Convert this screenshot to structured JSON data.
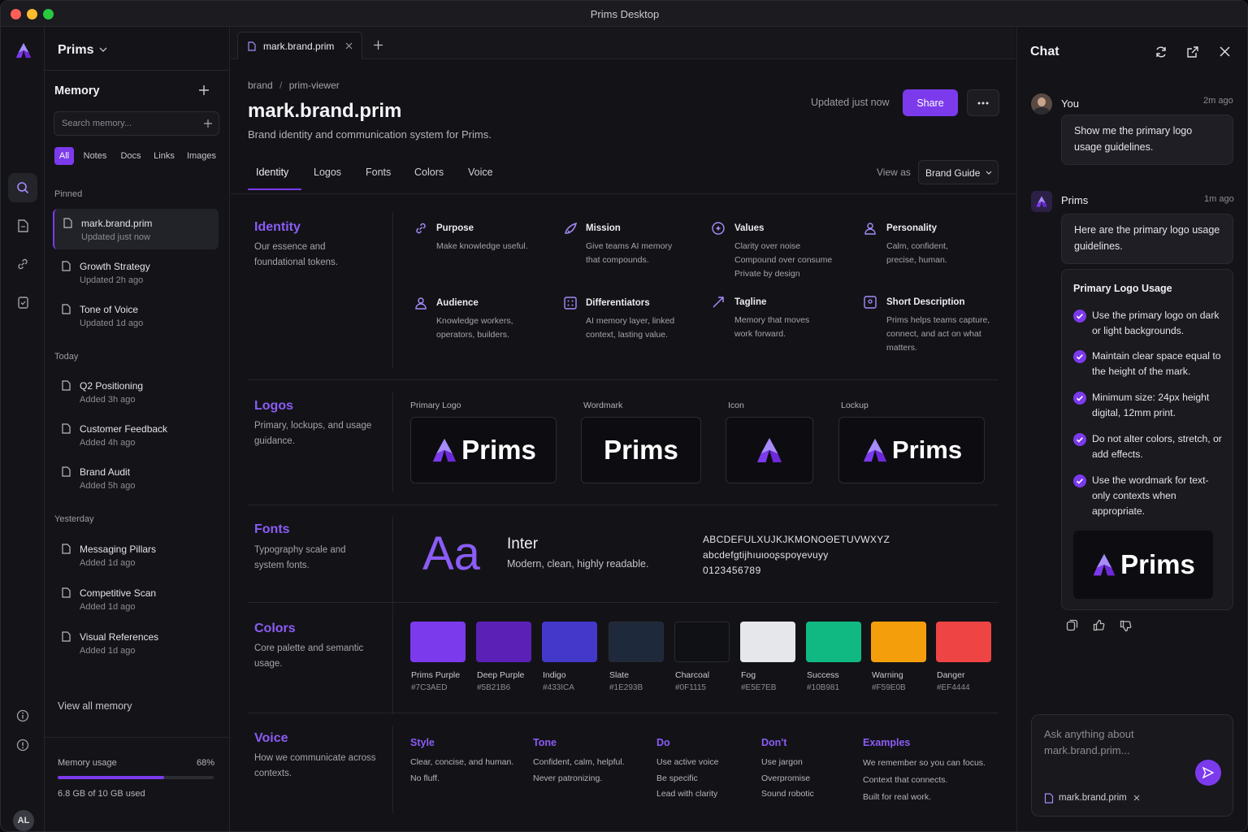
{
  "window": {
    "title": "Prims Desktop"
  },
  "sidebar": {
    "workspace": "Prims",
    "memory_title": "Memory",
    "search_placeholder": "Search memory...",
    "filters": [
      "All",
      "Notes",
      "Docs",
      "Links",
      "Images"
    ],
    "pinned_label": "Pinned",
    "pinned": [
      {
        "title": "mark.brand.prim",
        "sub": "Updated just now"
      },
      {
        "title": "Growth Strategy",
        "sub": "Updated 2h ago"
      },
      {
        "title": "Tone of Voice",
        "sub": "Updated 1d ago"
      }
    ],
    "today_label": "Today",
    "today": [
      {
        "title": "Q2 Positioning",
        "sub": "Added 3h ago"
      },
      {
        "title": "Customer Feedback",
        "sub": "Added 4h ago"
      },
      {
        "title": "Brand Audit",
        "sub": "Added 5h ago"
      }
    ],
    "yesterday_label": "Yesterday",
    "yesterday": [
      {
        "title": "Messaging Pillars",
        "sub": "Added 1d ago"
      },
      {
        "title": "Competitive Scan",
        "sub": "Added 1d ago"
      },
      {
        "title": "Visual References",
        "sub": "Added 1d ago"
      }
    ],
    "view_all": "View all memory",
    "usage_label": "Memory usage",
    "usage_pct": "68%",
    "usage_fraction": 0.68,
    "usage_detail": "6.8 GB of 10 GB used",
    "avatar": "AL"
  },
  "tab": {
    "label": "mark.brand.prim"
  },
  "doc": {
    "breadcrumb": [
      "brand",
      "prim-viewer"
    ],
    "title": "mark.brand.prim",
    "subtitle": "Brand identity and communication system for Prims.",
    "updated": "Updated just now",
    "share": "Share",
    "tabs": [
      "Identity",
      "Logos",
      "Fonts",
      "Colors",
      "Voice"
    ],
    "view_as_label": "View as",
    "view_as_value": "Brand Guide"
  },
  "identity": {
    "title": "Identity",
    "desc": "Our essence and foundational tokens.",
    "cards": [
      {
        "h": "Purpose",
        "b": "Make knowledge useful."
      },
      {
        "h": "Mission",
        "b": "Give teams AI memory\nthat compounds."
      },
      {
        "h": "Values",
        "b": "Clarity over noise\nCompound over consume\nPrivate by design"
      },
      {
        "h": "Personality",
        "b": "Calm, confident,\nprecise, human."
      },
      {
        "h": "Audience",
        "b": "Knowledge workers,\noperators, builders."
      },
      {
        "h": "Differentiators",
        "b": "AI memory layer, linked\ncontext, lasting value."
      },
      {
        "h": "Tagline",
        "b": "Memory that moves\nwork forward."
      },
      {
        "h": "Short Description",
        "b": "Prims helps teams capture,\nconnect, and act on what\nmatters."
      }
    ]
  },
  "logos": {
    "title": "Logos",
    "desc": "Primary, lockups, and usage guidance.",
    "items": [
      {
        "label": "Primary Logo",
        "word": "Prims"
      },
      {
        "label": "Wordmark",
        "word": "Prims"
      },
      {
        "label": "Icon",
        "word": ""
      },
      {
        "label": "Lockup",
        "word": "Prims"
      }
    ]
  },
  "fonts": {
    "title": "Fonts",
    "desc": "Typography scale and system fonts.",
    "sample": "Aa",
    "name": "Inter",
    "tagline": "Modern, clean, highly readable.",
    "upper": "ABCDEFULXUJKJKMONOΘETUVWXYZ",
    "lower": "abcdefgtijhıuιooʂspoγeνuyy",
    "digits": "0123456789"
  },
  "colors": {
    "title": "Colors",
    "desc": "Core palette and semantic usage.",
    "swatches": [
      {
        "name": "Prims Purple",
        "hex": "#7C3AED",
        "color": "#7C3AED"
      },
      {
        "name": "Deep Purple",
        "hex": "#5B21B6",
        "color": "#5B21B6"
      },
      {
        "name": "Indigo",
        "hex": "#433ICA",
        "color": "#4338CA"
      },
      {
        "name": "Slate",
        "hex": "#1E293B",
        "color": "#1E293B"
      },
      {
        "name": "Charcoal",
        "hex": "#0F1115",
        "color": "#0F1115"
      },
      {
        "name": "Fog",
        "hex": "#E5E7EB",
        "color": "#E5E7EB"
      },
      {
        "name": "Success",
        "hex": "#10B981",
        "color": "#10B981"
      },
      {
        "name": "Warning",
        "hex": "#F59E0B",
        "color": "#F59E0B"
      },
      {
        "name": "Danger",
        "hex": "#EF4444",
        "color": "#EF4444"
      }
    ]
  },
  "voice": {
    "title": "Voice",
    "desc": "How we communicate across contexts.",
    "cols": [
      {
        "h": "Style",
        "b": "Clear, concise, and human.\nNo fluff."
      },
      {
        "h": "Tone",
        "b": "Confident, calm, helpful.\nNever patronizing."
      },
      {
        "h": "Do",
        "b": "Use active voice\nBe specific\nLead with clarity"
      },
      {
        "h": "Don't",
        "b": "Use jargon\nOverpromise\nSound robotic"
      },
      {
        "h": "Examples",
        "b": "We remember so you can focus.\nContext that connects.\nBuilt for real work."
      }
    ]
  },
  "chat": {
    "title": "Chat",
    "user_name": "You",
    "user_time": "2m ago",
    "user_msg": "Show me the primary logo usage guidelines.",
    "bot_name": "Prims",
    "bot_time": "1m ago",
    "bot_msg": "Here are the primary logo usage guidelines.",
    "card_title": "Primary Logo Usage",
    "rules": [
      "Use the primary logo on dark or light backgrounds.",
      "Maintain clear space equal to the height of the mark.",
      "Minimum size: 24px height digital, 12mm print.",
      "Do not alter colors, stretch, or add effects.",
      "Use the wordmark for text-only contexts when appropriate."
    ],
    "card_logo_word": "Prims",
    "input_placeholder": "Ask anything about mark.brand.prim...",
    "attachment": "mark.brand.prim"
  },
  "colors_theme": {
    "accent": "#7C3AED",
    "accent_light": "#8B5CF6",
    "bg": "#131317"
  }
}
